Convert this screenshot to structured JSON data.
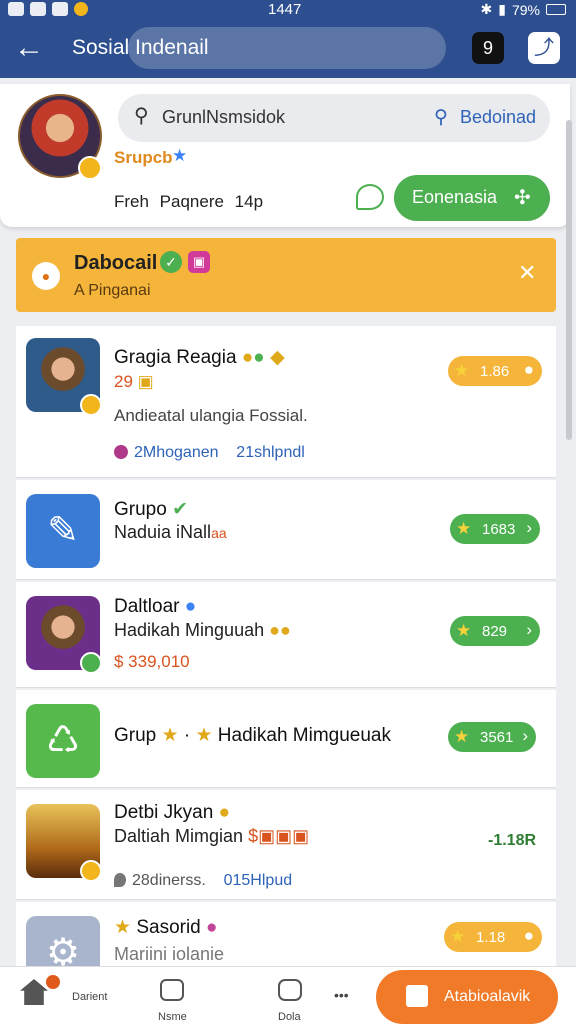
{
  "status_bar": {
    "time": "1447",
    "battery": "79%",
    "icons": [
      "notification-icon",
      "bluetooth-icon",
      "signal-icon",
      "battery-icon"
    ]
  },
  "app_bar": {
    "title": "Sosial Indenail",
    "back_icon": "back-arrow-icon"
  },
  "profile": {
    "name": "Srupcb",
    "stats": "Freh Paqnere 14p",
    "search": {
      "text": "GrunlNsmsidok",
      "action_label": "Bedoinad"
    },
    "primary_button": "Eonenasia"
  },
  "alert": {
    "title": "Dabocail",
    "subtitle": "A Pinganai"
  },
  "list": [
    {
      "title": "Gragia Reagia",
      "price": "29",
      "description": "Andieatal ulangia Fossial.",
      "meta_left": "2Mhoganen",
      "meta_right": "21shlpndl",
      "pill": "1.86"
    },
    {
      "title": "Grupo",
      "subtitle": "Naduia iNall",
      "subtitle_suffix": "aa",
      "pill": "1683"
    },
    {
      "title": "Daltloar",
      "subtitle": "Hadikah Minguuah",
      "price": "$ 339,010",
      "pill": "829"
    },
    {
      "title": "Grup",
      "title_suffix": "Hadikah Mimgueuak",
      "pill": "3561"
    },
    {
      "title": "Detbi Jkyan",
      "subtitle": "Daltiah Mimgian",
      "meta_left": "28dinerss.",
      "meta_right": "015Hlpud",
      "value": "-1.18R"
    },
    {
      "title": "Sasorid",
      "subtitle": "Mariini iolanie",
      "pill": "1.18"
    }
  ],
  "bottom_nav": {
    "items": [
      {
        "label": "Darient"
      },
      {
        "label": "Nsme"
      },
      {
        "label": "Dola"
      }
    ],
    "more": "•••",
    "cta": "Atabioalavik"
  },
  "colors": {
    "header": "#2d4f8f",
    "accent_green": "#4caf50",
    "accent_orange": "#f07a28",
    "banner": "#f4b53a"
  }
}
